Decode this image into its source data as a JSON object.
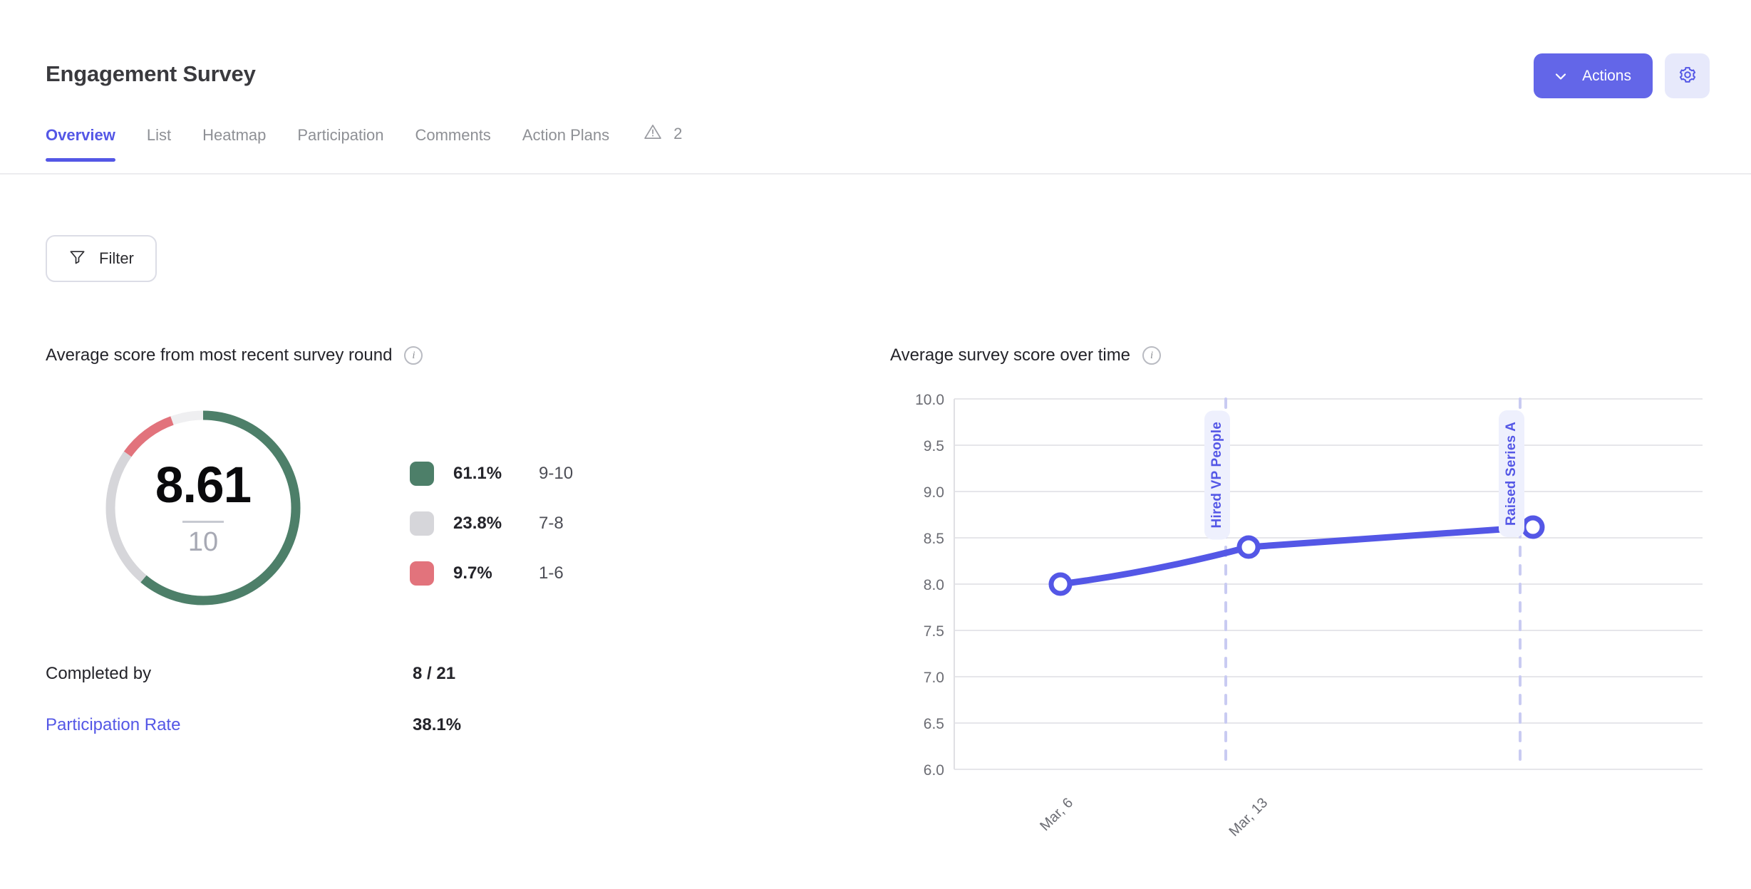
{
  "header": {
    "title": "Engagement Survey",
    "actions_button": "Actions",
    "actions_chevron_icon": "chevron-down-icon",
    "settings_icon": "gear-icon"
  },
  "tabs": [
    {
      "label": "Overview",
      "active": true
    },
    {
      "label": "List",
      "active": false
    },
    {
      "label": "Heatmap",
      "active": false
    },
    {
      "label": "Participation",
      "active": false
    },
    {
      "label": "Comments",
      "active": false
    },
    {
      "label": "Action Plans",
      "active": false
    }
  ],
  "warning": {
    "icon": "warning-triangle-icon",
    "count": "2"
  },
  "toolbar": {
    "filter_label": "Filter",
    "filter_icon": "funnel-icon"
  },
  "score_panel": {
    "heading": "Average score from most recent survey round",
    "info_icon": "info-icon",
    "info_glyph": "i",
    "donut": {
      "score": "8.61",
      "max": "10"
    },
    "legend": [
      {
        "color": "#4d7f69",
        "percent": "61.1%",
        "range": "9-10"
      },
      {
        "color": "#d6d6da",
        "percent": "23.8%",
        "range": "7-8"
      },
      {
        "color": "#e2737c",
        "percent": "9.7%",
        "range": "1-6"
      }
    ],
    "stats": [
      {
        "label": "Completed by",
        "value": "8 / 21",
        "is_link": false
      },
      {
        "label": "Participation Rate",
        "value": "38.1%",
        "is_link": true
      }
    ]
  },
  "time_panel": {
    "heading": "Average survey score over time",
    "info_icon": "info-icon",
    "info_glyph": "i"
  },
  "chart_data": {
    "type": "line",
    "title": "Average survey score over time",
    "xlabel": "",
    "ylabel": "",
    "x": [
      "Mar, 6",
      "Mar, 13",
      ""
    ],
    "categories": [
      "Mar, 6",
      "Mar, 13",
      ""
    ],
    "values": [
      8.0,
      8.4,
      8.61
    ],
    "series": [
      {
        "name": "Average survey score",
        "values": [
          8.0,
          8.4,
          8.61
        ],
        "color": "#5457e6"
      }
    ],
    "ylim": [
      6.0,
      10.0
    ],
    "yticks": [
      "10.0",
      "9.5",
      "9.0",
      "8.5",
      "8.0",
      "7.5",
      "7.0",
      "6.5",
      "6.0"
    ],
    "ytick_values": [
      10.0,
      9.5,
      9.0,
      8.5,
      8.0,
      7.5,
      7.0,
      6.5,
      6.0
    ],
    "xticks": [
      "Mar, 6",
      "Mar, 13"
    ],
    "grid": true,
    "legend": "none",
    "annotations": [
      {
        "label": "Hired VP People",
        "x_frac": 0.362,
        "color": "#5457e6"
      },
      {
        "label": "Raised Series A",
        "x_frac": 0.724,
        "color": "#5457e6"
      }
    ],
    "line_color": "#5457e6",
    "marker": "open-circle"
  },
  "colors": {
    "accent": "#5457e6",
    "actions_button": "#6366e8",
    "gear_button_bg": "#e7e9fb",
    "green": "#4d7f69",
    "gray": "#d6d6da",
    "red": "#e2737c",
    "grid": "#e6e6ea",
    "muted_text": "#8e9095"
  }
}
